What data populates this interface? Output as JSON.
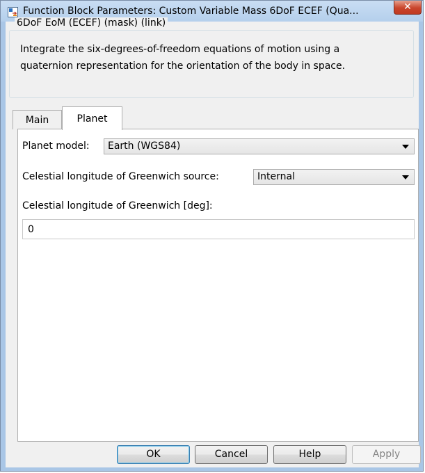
{
  "window": {
    "title": "Function Block Parameters: Custom Variable Mass 6DoF ECEF (Qua...",
    "close_glyph": "✕"
  },
  "group": {
    "legend": "6DoF EoM (ECEF) (mask) (link)",
    "description_lines": [
      "Integrate the six-degrees-of-freedom equations of motion using a",
      "quaternion representation for the orientation of the body in space."
    ]
  },
  "tabs": [
    {
      "label": "Main",
      "selected": false
    },
    {
      "label": "Planet",
      "selected": true
    }
  ],
  "planet_tab": {
    "planet_model_label": "Planet model:",
    "planet_model_value": "Earth (WGS84)",
    "greenwich_source_label": "Celestial longitude of Greenwich source:",
    "greenwich_source_value": "Internal",
    "greenwich_label": "Celestial longitude of Greenwich [deg]:",
    "greenwich_value": "0"
  },
  "buttons": {
    "ok": "OK",
    "cancel": "Cancel",
    "help": "Help",
    "apply": "Apply"
  },
  "icons": {
    "app": "simulink-block-icon",
    "close": "close-icon",
    "dropdown": "chevron-down-icon"
  }
}
